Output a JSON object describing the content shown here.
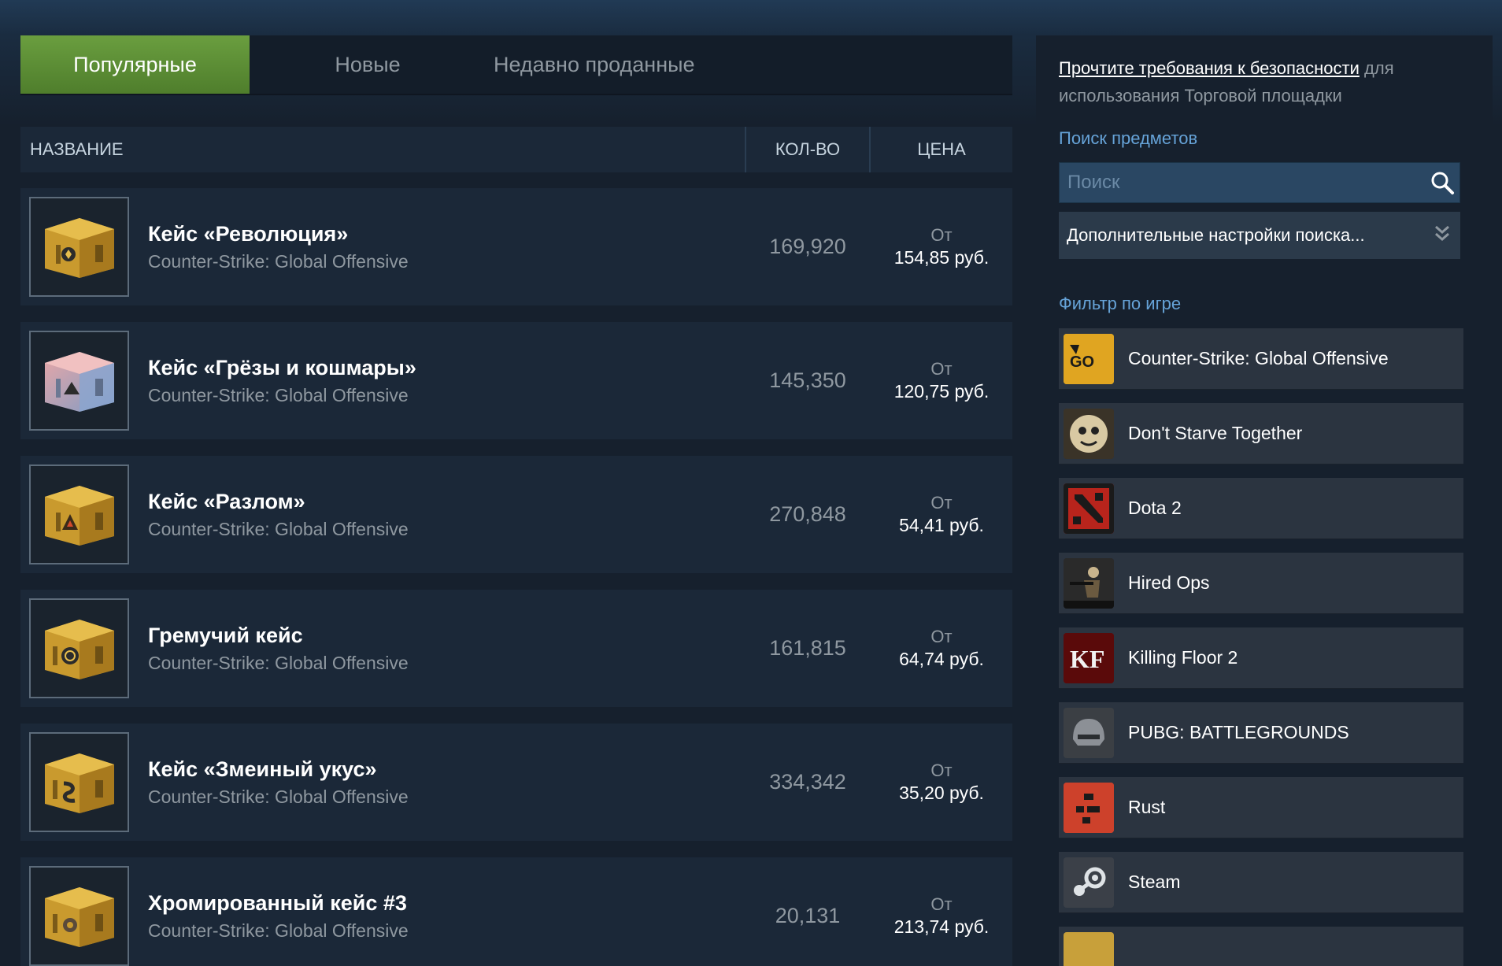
{
  "tabs": [
    {
      "label": "Популярные",
      "active": true
    },
    {
      "label": "Новые",
      "active": false
    },
    {
      "label": "Недавно проданные",
      "active": false
    }
  ],
  "table": {
    "col_name": "НАЗВАНИЕ",
    "col_qty": "КОЛ-ВО",
    "col_price": "ЦЕНА"
  },
  "listings": [
    {
      "name": "Кейс «Революция»",
      "game": "Counter-Strike: Global Offensive",
      "qty": "169,920",
      "from": "От",
      "price": "154,85 руб.",
      "icon": "revolution-case-icon"
    },
    {
      "name": "Кейс «Грёзы и кошмары»",
      "game": "Counter-Strike: Global Offensive",
      "qty": "145,350",
      "from": "От",
      "price": "120,75 руб.",
      "icon": "dreams-nightmares-case-icon"
    },
    {
      "name": "Кейс «Разлом»",
      "game": "Counter-Strike: Global Offensive",
      "qty": "270,848",
      "from": "От",
      "price": "54,41 руб.",
      "icon": "fracture-case-icon"
    },
    {
      "name": "Гремучий кейс",
      "game": "Counter-Strike: Global Offensive",
      "qty": "161,815",
      "from": "От",
      "price": "64,74 руб.",
      "icon": "snakebite-rattle-case-icon"
    },
    {
      "name": "Кейс «Змеиный укус»",
      "game": "Counter-Strike: Global Offensive",
      "qty": "334,342",
      "from": "От",
      "price": "35,20 руб.",
      "icon": "snakebite-case-icon"
    },
    {
      "name": "Хромированный кейс #3",
      "game": "Counter-Strike: Global Offensive",
      "qty": "20,131",
      "from": "От",
      "price": "213,74 руб.",
      "icon": "chroma-3-case-icon"
    }
  ],
  "sidebar": {
    "notice_link": "Прочтите требования к безопасности",
    "notice_rest": " для использования Торговой площадки",
    "search_title": "Поиск предметов",
    "search_placeholder": "Поиск",
    "advanced_label": "Дополнительные настройки поиска...",
    "filter_title": "Фильтр по игре",
    "games": [
      {
        "label": "Counter-Strike: Global Offensive",
        "icon": "csgo-icon"
      },
      {
        "label": "Don't Starve Together",
        "icon": "dont-starve-together-icon"
      },
      {
        "label": "Dota 2",
        "icon": "dota2-icon"
      },
      {
        "label": "Hired Ops",
        "icon": "hired-ops-icon"
      },
      {
        "label": "Killing Floor 2",
        "icon": "killing-floor-2-icon"
      },
      {
        "label": "PUBG: BATTLEGROUNDS",
        "icon": "pubg-icon"
      },
      {
        "label": "Rust",
        "icon": "rust-icon"
      },
      {
        "label": "Steam",
        "icon": "steam-icon"
      }
    ]
  },
  "colors": {
    "accent_green": "#5c8c34",
    "link_blue": "#66a3d8",
    "background": "#16202d"
  }
}
